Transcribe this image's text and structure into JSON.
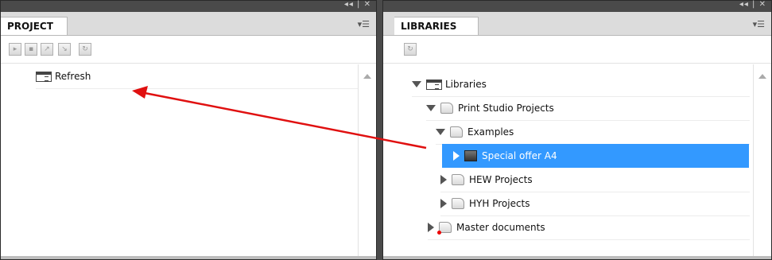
{
  "project_panel": {
    "tab_label": "PROJECT",
    "toolbar_icons": [
      "open-icon",
      "save-icon",
      "export-icon",
      "import-icon",
      "refresh-small-icon"
    ],
    "tree": [
      {
        "label": "Refresh",
        "icon": "window-icon"
      }
    ]
  },
  "libraries_panel": {
    "tab_label": "LIBRARIES",
    "toolbar_icons": [
      "refresh-small-icon"
    ],
    "tree": [
      {
        "label": "Libraries",
        "icon": "window-icon",
        "expanded": true,
        "depth": 0
      },
      {
        "label": "Print Studio Projects",
        "icon": "folder-icon",
        "expanded": true,
        "depth": 1
      },
      {
        "label": "Examples",
        "icon": "folder-icon",
        "expanded": true,
        "depth": 2
      },
      {
        "label": "Special offer A4",
        "icon": "document-icon",
        "expanded": false,
        "depth": 3,
        "selected": true
      },
      {
        "label": "HEW Projects",
        "icon": "folder-icon",
        "expanded": false,
        "depth": 2
      },
      {
        "label": "HYH Projects",
        "icon": "folder-icon",
        "expanded": false,
        "depth": 2
      },
      {
        "label": "Master documents",
        "icon": "folder-icon",
        "expanded": false,
        "depth": 1
      }
    ]
  },
  "colors": {
    "selection": "#3399ff",
    "annotation_arrow": "#e01010",
    "panel_frame": "#4a4a4a"
  }
}
